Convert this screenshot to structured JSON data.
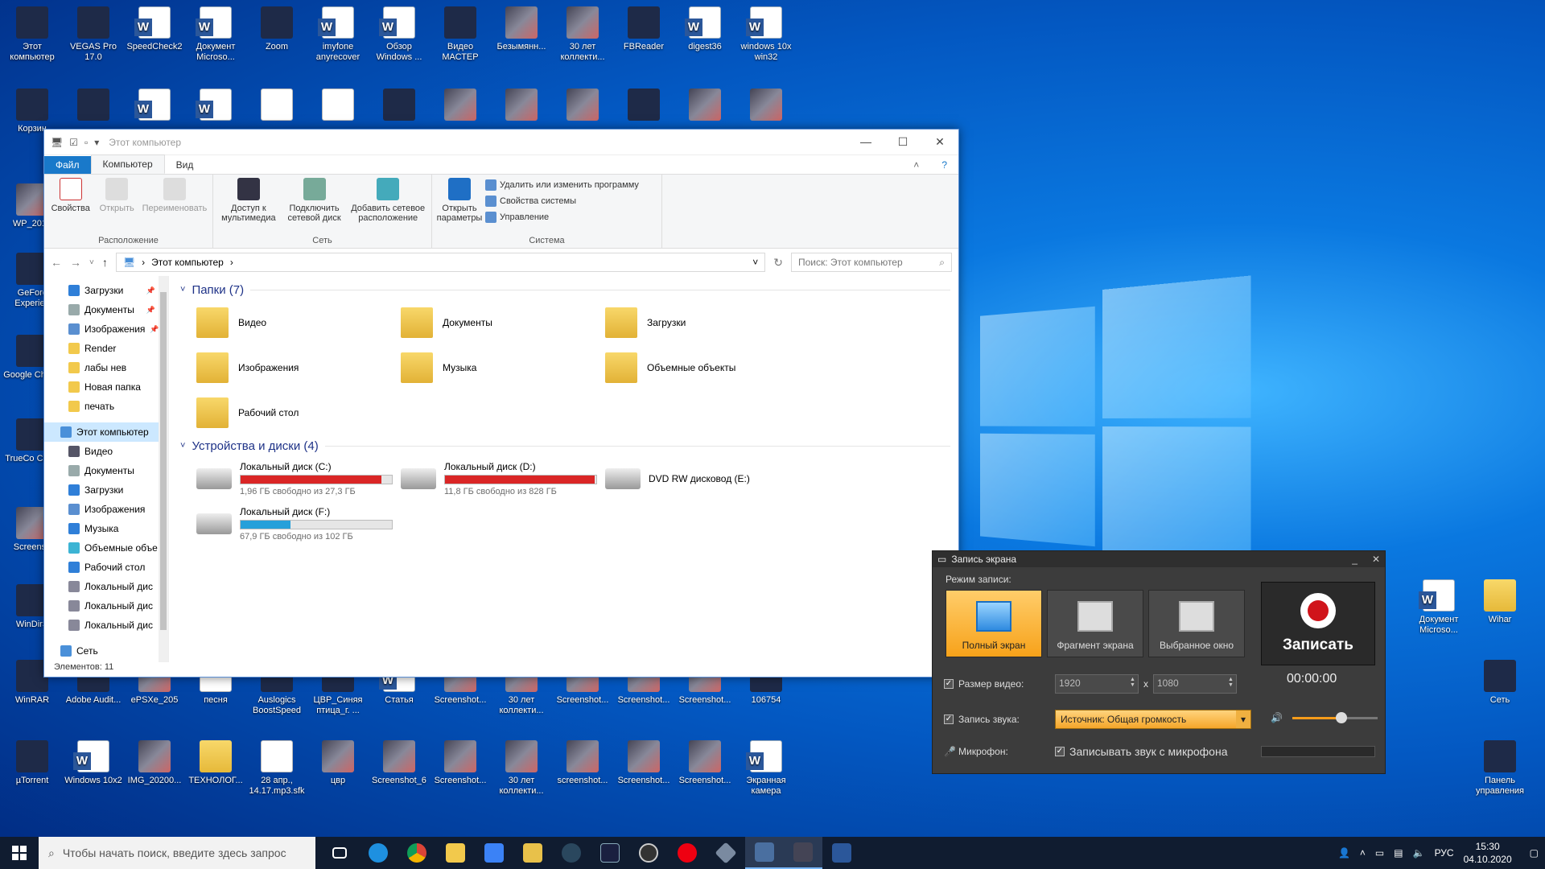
{
  "desktop_icons": [
    {
      "label": "Этот компьютер",
      "type": "app"
    },
    {
      "label": "VEGAS Pro 17.0",
      "type": "app"
    },
    {
      "label": "SpeedCheck2",
      "type": "word"
    },
    {
      "label": "Документ Microso...",
      "type": "word"
    },
    {
      "label": "Zoom",
      "type": "app"
    },
    {
      "label": "imyfone anyrecover",
      "type": "word"
    },
    {
      "label": "Обзор Windows ...",
      "type": "word"
    },
    {
      "label": "Видео МАСТЕР",
      "type": "app"
    },
    {
      "label": "Безымянн...",
      "type": "img"
    },
    {
      "label": "30 лет коллекти...",
      "type": "img"
    },
    {
      "label": "FBReader",
      "type": "app"
    },
    {
      "label": "digest36",
      "type": "word"
    },
    {
      "label": "windows 10x win32",
      "type": "word"
    },
    {
      "label": "Корзин",
      "type": "app"
    },
    {
      "label": "",
      "type": "app"
    },
    {
      "label": "",
      "type": "word"
    },
    {
      "label": "",
      "type": "word"
    },
    {
      "label": "",
      "type": "file"
    },
    {
      "label": "",
      "type": "file"
    },
    {
      "label": "",
      "type": "app"
    },
    {
      "label": "",
      "type": "img"
    },
    {
      "label": "",
      "type": "img"
    },
    {
      "label": "",
      "type": "img"
    },
    {
      "label": "",
      "type": "app"
    },
    {
      "label": "",
      "type": "img"
    },
    {
      "label": "",
      "type": "img"
    },
    {
      "label": "WP_2016",
      "type": "img"
    },
    {
      "label": "GeForc Experien",
      "type": "app"
    },
    {
      "label": "Google Chrom",
      "type": "app"
    },
    {
      "label": "TrueCo Client",
      "type": "app"
    },
    {
      "label": "Screensh",
      "type": "img"
    },
    {
      "label": "WinDirS",
      "type": "app"
    },
    {
      "label": "WinRAR",
      "type": "app"
    },
    {
      "label": "Adobe Audit...",
      "type": "app"
    },
    {
      "label": "ePSXe_205",
      "type": "img"
    },
    {
      "label": "песня",
      "type": "file"
    },
    {
      "label": "Auslogics BoostSpeed",
      "type": "app"
    },
    {
      "label": "ЦВР_Синяя птица_г. ...",
      "type": "app"
    },
    {
      "label": "Статья",
      "type": "word"
    },
    {
      "label": "Screenshot...",
      "type": "img"
    },
    {
      "label": "30 лет коллекти...",
      "type": "img"
    },
    {
      "label": "Screenshot...",
      "type": "img"
    },
    {
      "label": "Screenshot...",
      "type": "img"
    },
    {
      "label": "Screenshot...",
      "type": "img"
    },
    {
      "label": "106754",
      "type": "app"
    },
    {
      "label": "µTorrent",
      "type": "app"
    },
    {
      "label": "Windows 10x2",
      "type": "word"
    },
    {
      "label": "IMG_20200...",
      "type": "img"
    },
    {
      "label": "ТЕХНОЛОГ...",
      "type": "folder"
    },
    {
      "label": "28 апр., 14.17.mp3.sfk",
      "type": "file"
    },
    {
      "label": "цвр",
      "type": "img"
    },
    {
      "label": "Screenshot_6",
      "type": "img"
    },
    {
      "label": "Screenshot...",
      "type": "img"
    },
    {
      "label": "30 лет коллекти...",
      "type": "img"
    },
    {
      "label": "screenshot...",
      "type": "img"
    },
    {
      "label": "Screenshot...",
      "type": "img"
    },
    {
      "label": "Screenshot...",
      "type": "img"
    },
    {
      "label": "Экранная камера",
      "type": "word"
    },
    {
      "label": "Документ Microso...",
      "type": "word"
    },
    {
      "label": "Wihar",
      "type": "folder"
    },
    {
      "label": "Сеть",
      "type": "app"
    },
    {
      "label": "Панель управления",
      "type": "app"
    }
  ],
  "explorer": {
    "title": "Этот компьютер",
    "tabs": [
      "Файл",
      "Компьютер",
      "Вид"
    ],
    "ribbon": {
      "location_group": {
        "label": "Расположение",
        "buttons": [
          "Свойства",
          "Открыть",
          "Переименовать"
        ]
      },
      "network_group": {
        "label": "Сеть",
        "buttons": [
          "Доступ к мультимедиа",
          "Подключить сетевой диск",
          "Добавить сетевое расположение"
        ]
      },
      "system_group": {
        "label": "Система",
        "open_settings": "Открыть параметры",
        "items": [
          "Удалить или изменить программу",
          "Свойства системы",
          "Управление"
        ]
      }
    },
    "address": {
      "path": "Этот компьютер",
      "search_placeholder": "Поиск: Этот компьютер"
    },
    "nav": [
      {
        "label": "Загрузки",
        "pinned": true,
        "color": "#2f7fd8"
      },
      {
        "label": "Документы",
        "pinned": true,
        "color": "#9aa"
      },
      {
        "label": "Изображения",
        "pinned": true,
        "color": "#5a8fd0"
      },
      {
        "label": "Render",
        "color": "#f2c94c"
      },
      {
        "label": "лабы нев",
        "color": "#f2c94c"
      },
      {
        "label": "Новая папка",
        "color": "#f2c94c"
      },
      {
        "label": "печать",
        "color": "#f2c94c"
      },
      {
        "label": "Этот компьютер",
        "selected": true,
        "color": "#4a90d9"
      },
      {
        "label": "Видео",
        "color": "#556"
      },
      {
        "label": "Документы",
        "color": "#9aa"
      },
      {
        "label": "Загрузки",
        "color": "#2f7fd8"
      },
      {
        "label": "Изображения",
        "color": "#5a8fd0"
      },
      {
        "label": "Музыка",
        "color": "#2f7fd8"
      },
      {
        "label": "Объемные объе",
        "color": "#3cb4d4"
      },
      {
        "label": "Рабочий стол",
        "color": "#2f7fd8"
      },
      {
        "label": "Локальный дис",
        "color": "#889"
      },
      {
        "label": "Локальный дис",
        "color": "#889"
      },
      {
        "label": "Локальный дис",
        "color": "#889"
      },
      {
        "label": "Сеть",
        "color": "#4a90d9"
      }
    ],
    "folders_header": "Папки (7)",
    "folders": [
      "Видео",
      "Документы",
      "Загрузки",
      "Изображения",
      "Музыка",
      "Объемные объекты",
      "Рабочий стол"
    ],
    "devices_header": "Устройства и диски (4)",
    "drives": [
      {
        "name": "Локальный диск (C:)",
        "free": "1,96 ГБ свободно из 27,3 ГБ",
        "used_fraction": 0.93,
        "color": "#da2626"
      },
      {
        "name": "Локальный диск (D:)",
        "free": "11,8 ГБ свободно из 828 ГБ",
        "used_fraction": 0.99,
        "color": "#da2626"
      },
      {
        "name": "DVD RW дисковод (E:)",
        "free": "",
        "used_fraction": 0,
        "color": "#26a0da"
      },
      {
        "name": "Локальный диск (F:)",
        "free": "67,9 ГБ свободно из 102 ГБ",
        "used_fraction": 0.33,
        "color": "#26a0da"
      }
    ],
    "status": "Элементов: 11"
  },
  "recorder": {
    "title": "Запись экрана",
    "mode_label": "Режим записи:",
    "modes": [
      "Полный экран",
      "Фрагмент экрана",
      "Выбранное окно"
    ],
    "record_label": "Записать",
    "video_size_label": "Размер видео:",
    "width": "1920",
    "height": "1080",
    "times": "x",
    "timer": "00:00:00",
    "audio_label": "Запись звука:",
    "audio_source": "Источник: Общая громкость",
    "volume_fraction": 0.58,
    "mic_label": "Микрофон:",
    "mic_option": "Записывать звук с микрофона"
  },
  "taskbar": {
    "search_placeholder": "Чтобы начать поиск, введите здесь запрос",
    "lang": "РУС",
    "time": "15:30",
    "date": "04.10.2020"
  }
}
